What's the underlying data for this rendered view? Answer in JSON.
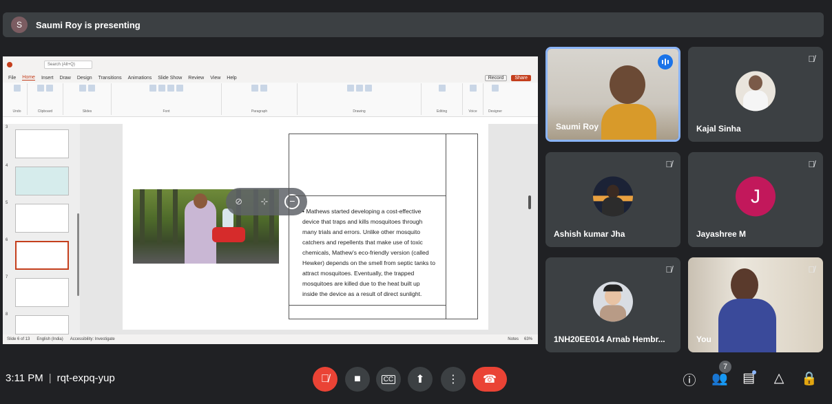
{
  "presenter_banner": {
    "avatar_letter": "S",
    "text": "Saumi Roy is presenting"
  },
  "ppt": {
    "menu": [
      "File",
      "Home",
      "Insert",
      "Draw",
      "Design",
      "Transitions",
      "Animations",
      "Slide Show",
      "Review",
      "View",
      "Help"
    ],
    "record_label": "Record",
    "share_label": "Share",
    "search_placeholder": "Search (Alt+Q)",
    "ribbon_groups": [
      "Undo",
      "Clipboard",
      "Slides",
      "Font",
      "Paragraph",
      "Drawing",
      "Editing",
      "Voice",
      "Designer"
    ],
    "slide_numbers": [
      "3",
      "4",
      "5",
      "6",
      "7",
      "8"
    ],
    "slide_text": "Mathews started developing a cost-effective device that traps and kills mosquitoes through many trials and errors. Unlike other mosquito catchers and repellents that make use of toxic chemicals, Mathew's eco-friendly version (called Hewker) depends on the smell from septic tanks to attract mosquitoes. Eventually, the trapped mosquitoes are killed due to the heat built up inside the device as a result of direct sunlight.",
    "status_left": "Slide 6 of 13",
    "status_lang": "English (India)",
    "status_access": "Accessibility: Investigate",
    "status_notes": "Notes",
    "zoom": "63%"
  },
  "participants": [
    {
      "name": "Saumi Roy",
      "muted": false,
      "speaking": true
    },
    {
      "name": "Kajal Sinha",
      "muted": true
    },
    {
      "name": "Ashish kumar Jha",
      "muted": true
    },
    {
      "name": "Jayashree M",
      "muted": true,
      "initial": "J"
    },
    {
      "name": "1NH20EE014 Arnab Hembr...",
      "muted": true
    },
    {
      "name": "You",
      "muted": true
    }
  ],
  "meeting": {
    "time": "3:11 PM",
    "code": "rqt-expq-yup",
    "participant_count": "7"
  },
  "colors": {
    "end_call": "#ea4335",
    "accent": "#8ab4f8",
    "ppt_accent": "#c43e1c",
    "jayashree_avatar": "#c2185b"
  }
}
